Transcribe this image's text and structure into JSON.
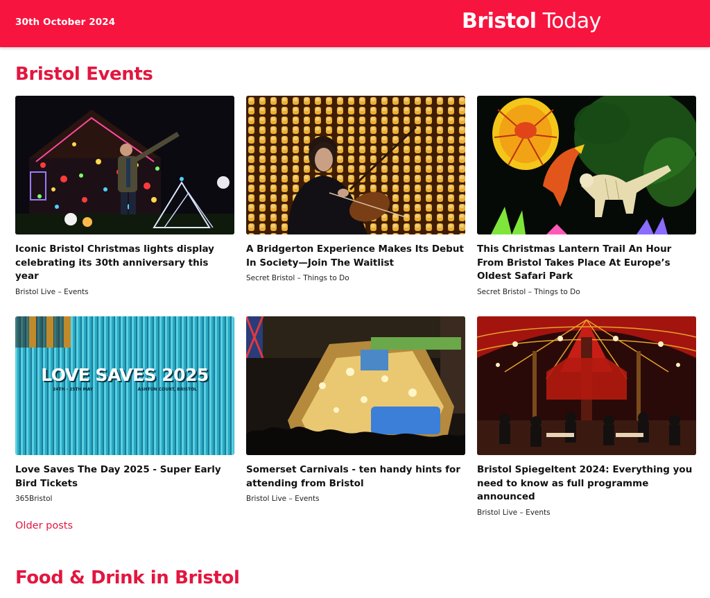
{
  "header": {
    "date": "30th October 2024",
    "brand_bold": "Bristol",
    "brand_light": " Today"
  },
  "sections": {
    "events_title": "Bristol Events",
    "food_title": "Food & Drink in Bristol"
  },
  "events": [
    {
      "title": "Iconic Bristol Christmas lights display celebrating its 30th anniversary this year",
      "source": "Bristol Live – Events"
    },
    {
      "title": "A Bridgerton Experience Makes Its Debut In Society—Join The Waitlist",
      "source": "Secret Bristol – Things to Do"
    },
    {
      "title": "This Christmas Lantern Trail An Hour From Bristol Takes Place At Europe’s Oldest Safari Park",
      "source": "Secret Bristol – Things to Do"
    },
    {
      "title": "Love Saves The Day 2025 - Super Early Bird Tickets",
      "source": "365Bristol"
    },
    {
      "title": "Somerset Carnivals - ten handy hints for attending from Bristol",
      "source": "Bristol Live – Events"
    },
    {
      "title": "Bristol Spiegeltent 2024: Everything you need to know as full programme announced",
      "source": "Bristol Live – Events"
    }
  ],
  "poster": {
    "headline": "LOVE SAVES 2025",
    "dates": "24TH - 25TH MAY",
    "venue": "ASHTON COURT, BRISTOL"
  },
  "pagination": {
    "older_label": "Older posts"
  },
  "colors": {
    "accent": "#f7143f",
    "heading": "#e3163f"
  }
}
